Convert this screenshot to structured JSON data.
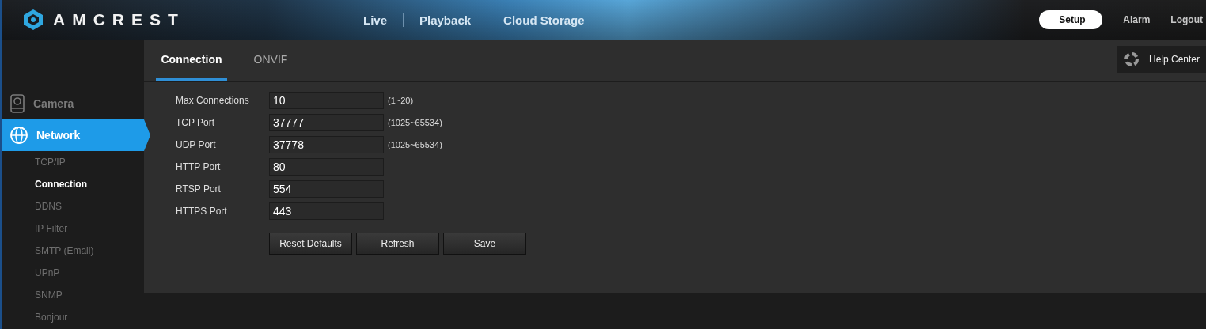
{
  "header": {
    "brand": "AMCREST",
    "nav": [
      {
        "label": "Live"
      },
      {
        "label": "Playback"
      },
      {
        "label": "Cloud Storage"
      }
    ],
    "menu": [
      {
        "label": "Setup",
        "selected": true
      },
      {
        "label": "Alarm",
        "selected": false
      },
      {
        "label": "Logout",
        "selected": false
      }
    ]
  },
  "sidebar": {
    "sections": [
      {
        "label": "Camera",
        "selected": false
      },
      {
        "label": "Network",
        "selected": true
      }
    ],
    "items": [
      {
        "label": "TCP/IP",
        "selected": false
      },
      {
        "label": "Connection",
        "selected": true
      },
      {
        "label": "DDNS",
        "selected": false
      },
      {
        "label": "IP Filter",
        "selected": false
      },
      {
        "label": "SMTP (Email)",
        "selected": false
      },
      {
        "label": "UPnP",
        "selected": false
      },
      {
        "label": "SNMP",
        "selected": false
      },
      {
        "label": "Bonjour",
        "selected": false
      }
    ]
  },
  "tabs": [
    {
      "label": "Connection",
      "selected": true
    },
    {
      "label": "ONVIF",
      "selected": false
    }
  ],
  "help": "Help Center",
  "fields": [
    {
      "label": "Max Connections",
      "value": "10",
      "hint": "(1~20)"
    },
    {
      "label": "TCP Port",
      "value": "37777",
      "hint": "(1025~65534)"
    },
    {
      "label": "UDP Port",
      "value": "37778",
      "hint": "(1025~65534)"
    },
    {
      "label": "HTTP Port",
      "value": "80"
    },
    {
      "label": "RTSP Port",
      "value": "554"
    },
    {
      "label": "HTTPS Port",
      "value": "443"
    }
  ],
  "buttons": [
    "Reset Defaults",
    "Refresh",
    "Save"
  ]
}
